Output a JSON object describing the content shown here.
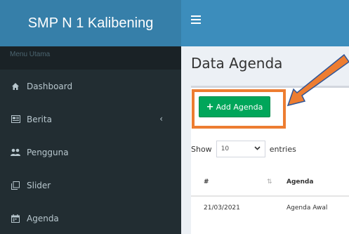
{
  "brand": {
    "title": "SMP N 1 Kalibening"
  },
  "sidebar": {
    "header": "Menu Utama",
    "items": [
      {
        "label": "Dashboard",
        "icon": "home-icon"
      },
      {
        "label": "Berita",
        "icon": "newspaper-icon",
        "chevron": "‹"
      },
      {
        "label": "Pengguna",
        "icon": "users-icon"
      },
      {
        "label": "Slider",
        "icon": "slider-icon"
      },
      {
        "label": "Agenda",
        "icon": "calendar-icon"
      }
    ]
  },
  "content": {
    "title": "Data Agenda",
    "add_button": "Add Agenda",
    "show": "Show",
    "entries_value": "10",
    "entries": "entries",
    "table": {
      "headers": [
        "#",
        "Agenda"
      ],
      "rows": [
        [
          "21/03/2021",
          "Agenda Awal"
        ]
      ]
    }
  },
  "colors": {
    "header": "#3c8dbc",
    "brand": "#367fa9",
    "sidebar": "#222d32",
    "add_button": "#00a65a",
    "highlight": "#ed7d31"
  }
}
